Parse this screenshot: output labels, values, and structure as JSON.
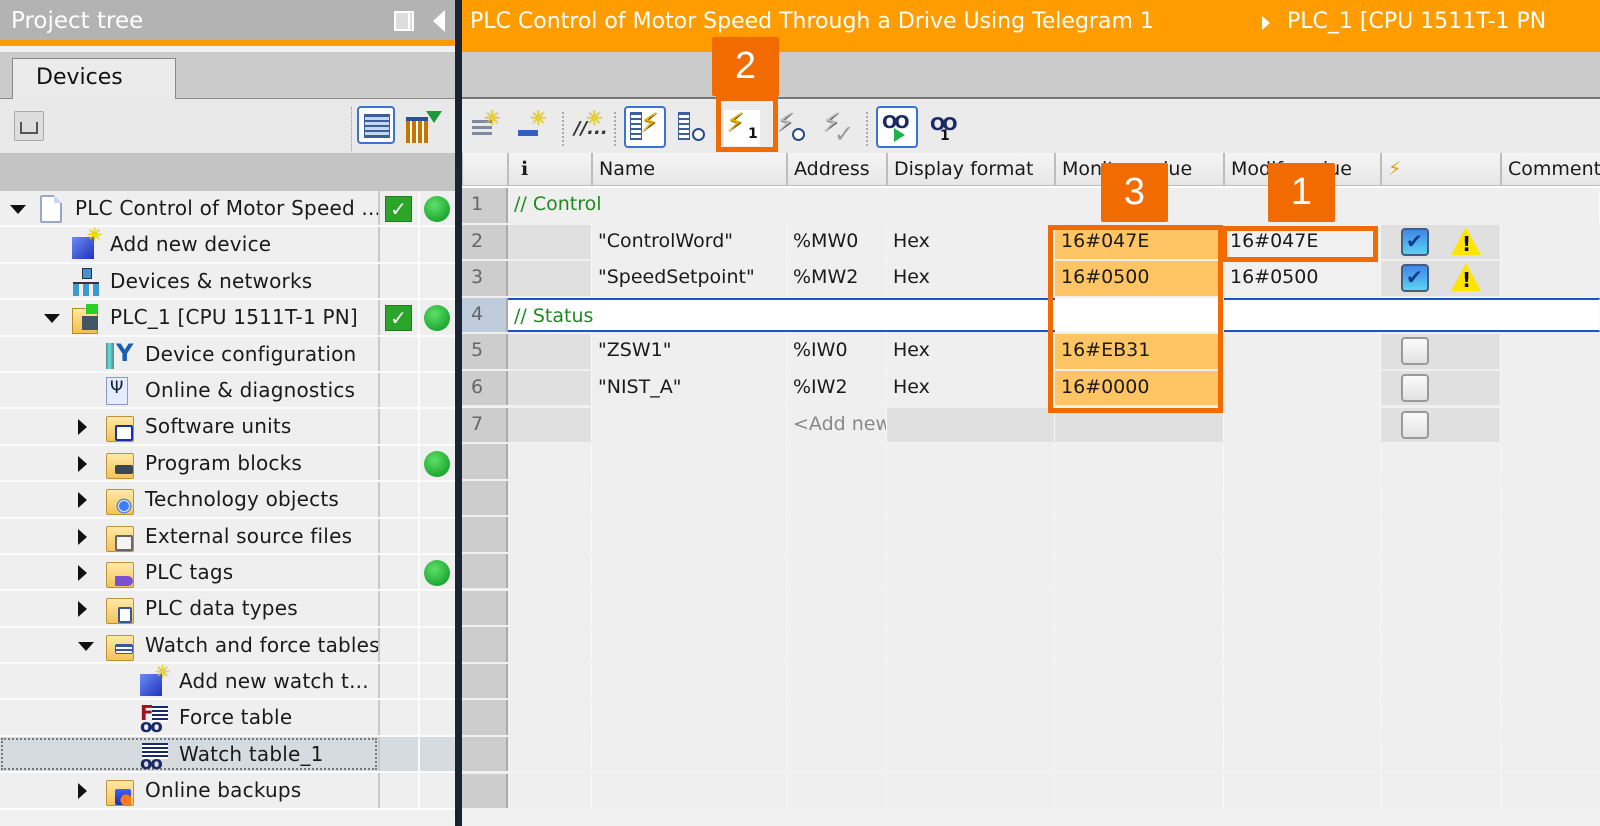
{
  "project_tree": {
    "title": "Project tree",
    "tab": "Devices",
    "items": [
      {
        "label": "PLC Control of Motor Speed ...",
        "level": 0,
        "expander": "open",
        "icon": "project-icon",
        "check": true,
        "dot": true
      },
      {
        "label": "Add new device",
        "level": 1,
        "expander": "none",
        "icon": "add-device-icon",
        "check": false,
        "dot": false
      },
      {
        "label": "Devices & networks",
        "level": 1,
        "expander": "none",
        "icon": "network-icon",
        "check": false,
        "dot": false
      },
      {
        "label": "PLC_1 [CPU 1511T-1 PN]",
        "level": 1,
        "expander": "open",
        "icon": "plc-icon",
        "check": true,
        "dot": true
      },
      {
        "label": "Device configuration",
        "level": 2,
        "expander": "none",
        "icon": "device-configuration-icon",
        "check": false,
        "dot": false
      },
      {
        "label": "Online & diagnostics",
        "level": 2,
        "expander": "none",
        "icon": "diagnostics-icon",
        "check": false,
        "dot": false
      },
      {
        "label": "Software units",
        "level": 2,
        "expander": "closed",
        "icon": "software-units-folder-icon",
        "check": false,
        "dot": false
      },
      {
        "label": "Program blocks",
        "level": 2,
        "expander": "closed",
        "icon": "program-blocks-folder-icon",
        "check": false,
        "dot": true
      },
      {
        "label": "Technology objects",
        "level": 2,
        "expander": "closed",
        "icon": "technology-objects-folder-icon",
        "check": false,
        "dot": false
      },
      {
        "label": "External source files",
        "level": 2,
        "expander": "closed",
        "icon": "external-source-folder-icon",
        "check": false,
        "dot": false
      },
      {
        "label": "PLC tags",
        "level": 2,
        "expander": "closed",
        "icon": "plc-tags-folder-icon",
        "check": false,
        "dot": true
      },
      {
        "label": "PLC data types",
        "level": 2,
        "expander": "closed",
        "icon": "plc-data-types-folder-icon",
        "check": false,
        "dot": false
      },
      {
        "label": "Watch and force tables",
        "level": 2,
        "expander": "open",
        "icon": "watch-force-folder-icon",
        "check": false,
        "dot": false
      },
      {
        "label": "Add new watch t...",
        "level": 3,
        "expander": "none",
        "icon": "add-watch-table-icon",
        "check": false,
        "dot": false
      },
      {
        "label": "Force table",
        "level": 3,
        "expander": "none",
        "icon": "force-table-icon",
        "check": false,
        "dot": false
      },
      {
        "label": "Watch table_1",
        "level": 3,
        "expander": "none",
        "icon": "watch-table-icon",
        "check": false,
        "dot": false,
        "selected": true
      },
      {
        "label": "Online backups",
        "level": 2,
        "expander": "closed",
        "icon": "online-backups-folder-icon",
        "check": false,
        "dot": false
      }
    ]
  },
  "breadcrumb": {
    "project": "PLC Control of Motor Speed Through a Drive Using Telegram 1",
    "device": "PLC_1 [CPU 1511T-1 PN"
  },
  "toolbar": {
    "buttons": [
      "insert-row-icon",
      "add-row-icon",
      "insert-comment-row-icon",
      "show-modify-columns-icon",
      "show-trigger-columns-icon",
      "modify-now-icon",
      "modify-with-trigger-icon",
      "enable-peripheral-outputs-icon",
      "monitor-all-icon",
      "monitor-now-icon"
    ]
  },
  "annotations": {
    "one": "1",
    "two": "2",
    "three": "3"
  },
  "table": {
    "headers": {
      "info": "i",
      "name": "Name",
      "address": "Address",
      "display_format": "Display format",
      "monitor_value": "Monitor value",
      "modify_value": "Modify value",
      "modify_flag": "⚡",
      "comment": "Comment"
    },
    "rows": [
      {
        "num": "1",
        "type": "comment",
        "comment": "// Control"
      },
      {
        "num": "2",
        "type": "tag",
        "name": "\"ControlWord\"",
        "address": "%MW0",
        "format": "Hex",
        "monitor": "16#047E",
        "modify": "16#047E",
        "checked": true,
        "warning": true
      },
      {
        "num": "3",
        "type": "tag",
        "name": "\"SpeedSetpoint\"",
        "address": "%MW2",
        "format": "Hex",
        "monitor": "16#0500",
        "modify": "16#0500",
        "checked": true,
        "warning": true
      },
      {
        "num": "4",
        "type": "comment",
        "comment": "// Status",
        "editing": true
      },
      {
        "num": "5",
        "type": "tag",
        "name": "\"ZSW1\"",
        "address": "%IW0",
        "format": "Hex",
        "monitor": "16#EB31",
        "modify": "",
        "checked": false,
        "warning": false
      },
      {
        "num": "6",
        "type": "tag",
        "name": "\"NIST_A\"",
        "address": "%IW2",
        "format": "Hex",
        "monitor": "16#0000",
        "modify": "",
        "checked": false,
        "warning": false
      },
      {
        "num": "7",
        "type": "add",
        "address": "<Add new>",
        "checked": false
      }
    ]
  },
  "colors": {
    "accent_orange": "#ff9c00",
    "annotation_orange": "#f26b00",
    "monitor_highlight": "#ffc565",
    "status_green": "#2aa52a",
    "comment_green": "#1e8a1e"
  }
}
